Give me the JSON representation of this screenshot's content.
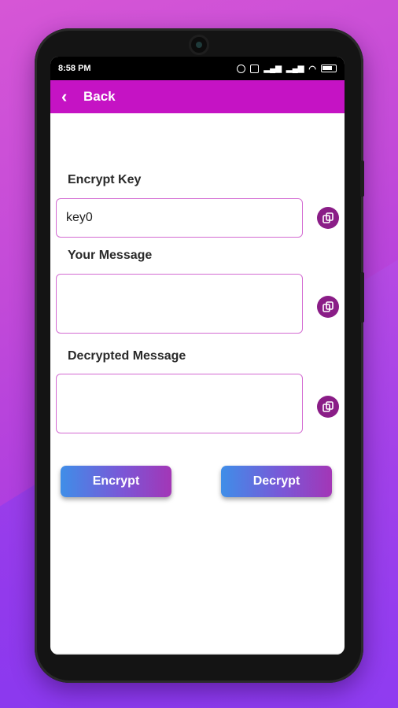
{
  "status_bar": {
    "time": "8:58 PM"
  },
  "app_bar": {
    "back_label": "Back"
  },
  "form": {
    "encrypt_key_label": "Encrypt Key",
    "encrypt_key_value": "key0",
    "message_label": "Your Message",
    "message_value": "",
    "decrypted_label": "Decrypted Message",
    "decrypted_value": ""
  },
  "actions": {
    "encrypt_label": "Encrypt",
    "decrypt_label": "Decrypt"
  },
  "icons": {
    "back": "chevron-left-icon",
    "copy": "copy-icon"
  },
  "colors": {
    "app_bar": "#c513c4",
    "copy_button": "#8a1d87",
    "button_gradient_start": "#3f8ee8",
    "button_gradient_end": "#a336b6",
    "field_border": "#d36ad2"
  }
}
